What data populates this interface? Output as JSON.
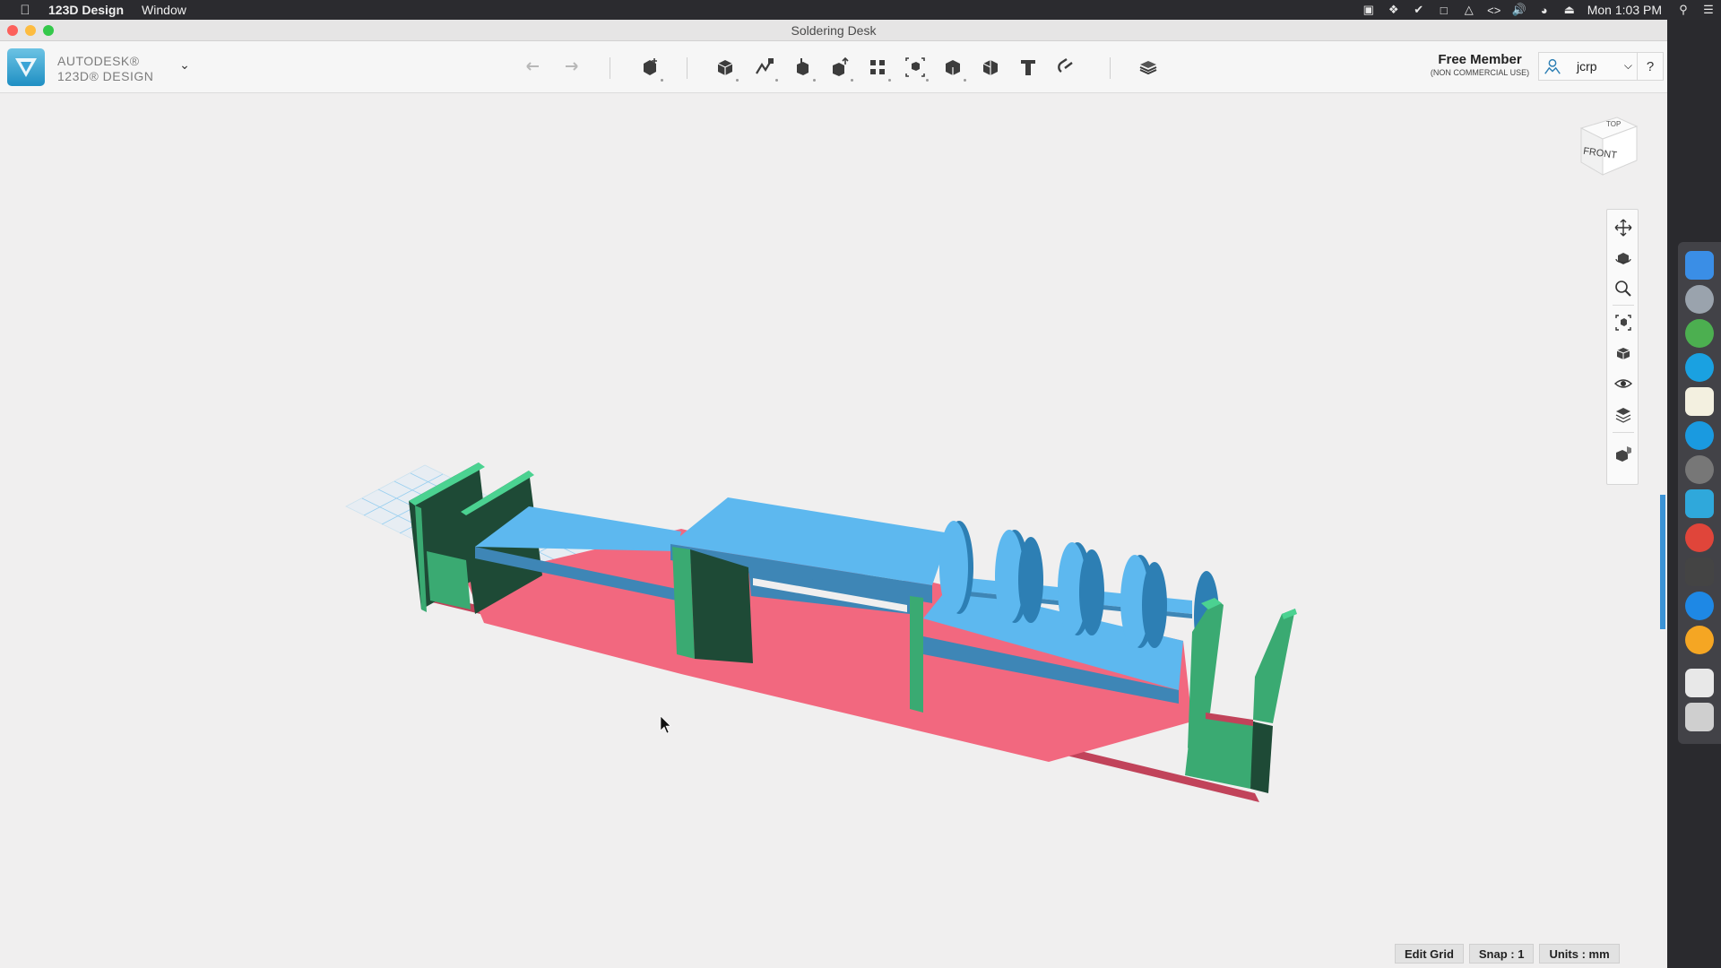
{
  "menubar": {
    "app_name": "123D Design",
    "menus": [
      "Window"
    ],
    "clock": "Mon 1:03 PM"
  },
  "window": {
    "title": "Soldering Desk"
  },
  "toolbar": {
    "brand_line1": "AUTODESK®",
    "brand_line2": "123D® DESIGN",
    "tools": [
      {
        "name": "undo-icon"
      },
      {
        "name": "redo-icon"
      },
      {
        "name": "transform-icon"
      },
      {
        "name": "primitives-icon"
      },
      {
        "name": "sketch-icon"
      },
      {
        "name": "construct-icon"
      },
      {
        "name": "modify-icon"
      },
      {
        "name": "pattern-icon"
      },
      {
        "name": "grouping-icon"
      },
      {
        "name": "combine-icon"
      },
      {
        "name": "measure-icon"
      },
      {
        "name": "text-icon"
      },
      {
        "name": "snap-icon"
      },
      {
        "name": "material-icon"
      }
    ],
    "member_title": "Free Member",
    "member_subtitle": "(NON COMMERCIAL USE)",
    "username": "jcrp",
    "help_label": "?"
  },
  "viewcube": {
    "top_label": "TOP",
    "front_label": "FRONT"
  },
  "nav_tools": [
    "pan-icon",
    "orbit-icon",
    "zoom-icon",
    "fit-icon",
    "views-icon",
    "visibility-icon",
    "grid-view-icon",
    "object-icon"
  ],
  "status": {
    "edit_grid": "Edit Grid",
    "snap": "Snap :  1",
    "units": "Units : mm"
  },
  "colors": {
    "green": "#3aaa72",
    "dark_green": "#1e4a36",
    "blue": "#5db8ef",
    "pink": "#f2687f",
    "grid": "#8ecbf0"
  }
}
